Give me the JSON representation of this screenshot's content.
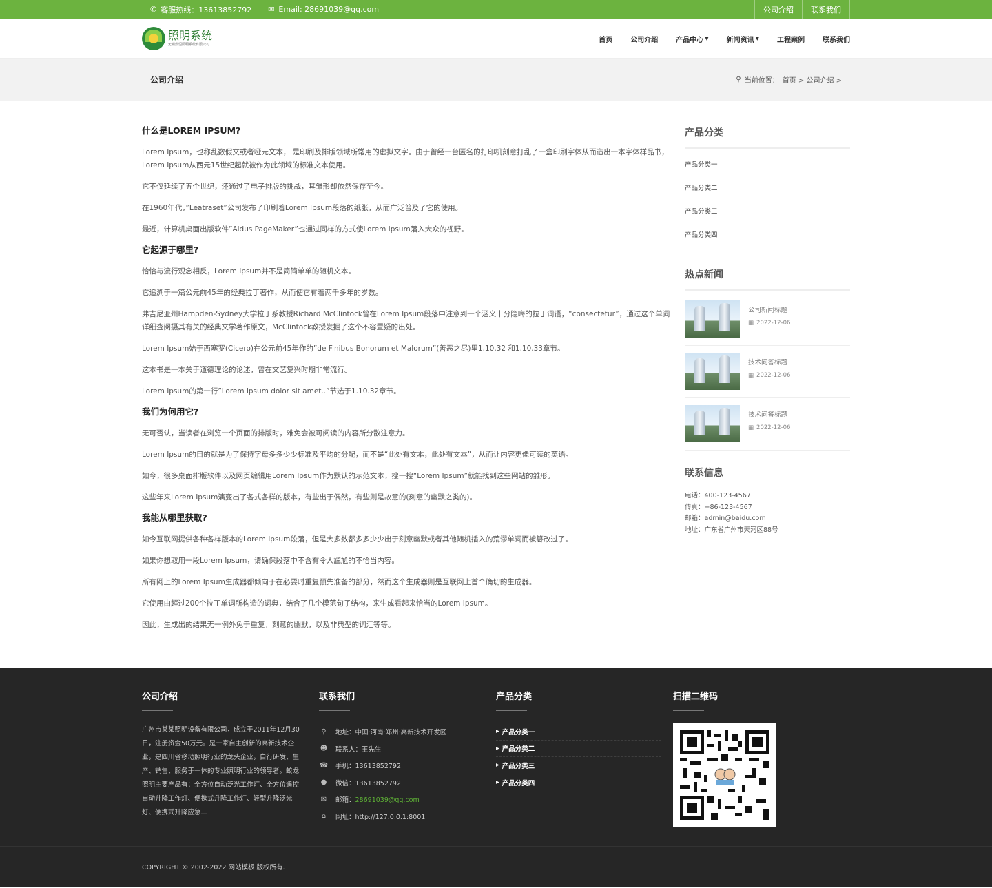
{
  "topbar": {
    "hotline": "客服热线：13613852792",
    "email": "Email: 28691039@qq.com",
    "links": [
      "公司介绍",
      "联系我们"
    ],
    "accent": "#6cb33f"
  },
  "header": {
    "logo_name": "照明系统",
    "logo_sub": "无锡鼎恒照明系统有限公司",
    "nav": [
      {
        "label": "首页",
        "dropdown": false
      },
      {
        "label": "公司介绍",
        "dropdown": false
      },
      {
        "label": "产品中心",
        "dropdown": true
      },
      {
        "label": "新闻资讯",
        "dropdown": true
      },
      {
        "label": "工程案例",
        "dropdown": false
      },
      {
        "label": "联系我们",
        "dropdown": false
      }
    ]
  },
  "banner": {
    "title": "公司介绍",
    "crumb_label": "当前位置：",
    "crumb_path": "首页 > 公司介绍 >"
  },
  "article": {
    "h1": "什么是LOREM IPSUM?",
    "p1": "Lorem Ipsum，也称乱数假文或者哑元文本， 是印刷及排版领域所常用的虚拟文字。由于曾经一台匿名的打印机刻意打乱了一盒印刷字体从而造出一本字体样品书，Lorem Ipsum从西元15世纪起就被作为此领域的标准文本使用。",
    "p2": "它不仅延续了五个世纪，还通过了电子排版的挑战，其雏形却依然保存至今。",
    "p3": "在1960年代，”Leatraset”公司发布了印刷着Lorem Ipsum段落的纸张，从而广泛普及了它的使用。",
    "p4": "最近，计算机桌面出版软件”Aldus PageMaker”也通过同样的方式使Lorem Ipsum落入大众的视野。",
    "h2": "它起源于哪里?",
    "p5": "恰恰与流行观念相反，Lorem Ipsum并不是简简单单的随机文本。",
    "p6": "它追溯于一篇公元前45年的经典拉丁著作，从而使它有着两千多年的岁数。",
    "p7": "弗吉尼亚州Hampden-Sydney大学拉丁系教授Richard McClintock曾在Lorem Ipsum段落中注意到一个涵义十分隐晦的拉丁词语，“consectetur”，通过这个单词详细查阅摄其有关的经典文学著作原文，McClintock教授发掘了这个不容置疑的出处。",
    "p8": "Lorem Ipsum始于西塞罗(Cicero)在公元前45年作的”de Finibus Bonorum et Malorum”(善恶之尽)里1.10.32 和1.10.33章节。",
    "p9": "这本书是一本关于道德理论的论述，曾在文艺复兴时期非常流行。",
    "p10": "Lorem Ipsum的第一行”Lorem ipsum dolor sit amet..”节选于1.10.32章节。",
    "h3": "我们为何用它?",
    "p11": "无可否认，当读者在浏览一个页面的排版时，难免会被可阅读的内容所分散注意力。",
    "p12": "Lorem Ipsum的目的就是为了保持字母多多少少标准及平均的分配，而不是“此处有文本，此处有文本”，从而让内容更像可读的英语。",
    "p13": "如今，很多桌面排版软件以及网页编辑用Lorem Ipsum作为默认的示范文本，搜一搜“Lorem Ipsum”就能找到这些网站的雏形。",
    "p14": "这些年来Lorem Ipsum演变出了各式各样的版本，有些出于偶然，有些则是故意的(刻意的幽默之类的)。",
    "h4": "我能从哪里获取?",
    "p15": "如今互联网提供各种各样版本的Lorem Ipsum段落，但是大多数都多多少少出于刻意幽默或者其他随机插入的荒谬单词而被篡改过了。",
    "p16": "如果你想取用一段Lorem Ipsum，请确保段落中不含有令人尴尬的不恰当内容。",
    "p17": "所有网上的Lorem Ipsum生成器都倾向于在必要时重复预先准备的部分，然而这个生成器则是互联网上首个确切的生成器。",
    "p18": "它使用由超过200个拉丁单词所构造的词典，结合了几个模范句子结构，来生成看起来恰当的Lorem Ipsum。",
    "p19": "因此，生成出的结果无一例外免于重复，刻意的幽默，以及非典型的词汇等等。"
  },
  "sidebar": {
    "cat_title": "产品分类",
    "cats": [
      "产品分类一",
      "产品分类二",
      "产品分类三",
      "产品分类四"
    ],
    "news_title": "热点新闻",
    "news": [
      {
        "title": "公司新闻标题",
        "date": "2022-12-06"
      },
      {
        "title": "技术问答标题",
        "date": "2022-12-06"
      },
      {
        "title": "技术问答标题",
        "date": "2022-12-06"
      }
    ],
    "contact_title": "联系信息",
    "contact": [
      "电话：400-123-4567",
      "传真：+86-123-4567",
      "邮箱：admin@baidu.com",
      "地址：广东省广州市天河区88号"
    ]
  },
  "footer": {
    "about_title": "公司介绍",
    "about_text": "广州市某某照明设备有限公司，成立于2011年12月30日，注册资金50万元。是一家自主创新的高新技术企业，是四川省移动照明行业的龙头企业，自行研发、生产、销售、服务于一体的专业照明行业的领导者。蛟龙照明主要产品有：全方位自动泛光工作灯、全方位遥控自动升降工作灯、便携式升降工作灯、轻型升降泛光灯、便携式升降应急...",
    "contact_title": "联系我们",
    "contact": [
      {
        "icon": "map-marker-icon",
        "label": "地址：",
        "value": "中国·河南·郑州·高新技术开发区"
      },
      {
        "icon": "user-icon",
        "label": "联系人：",
        "value": "王先生"
      },
      {
        "icon": "phone-icon",
        "label": "手机：",
        "value": "13613852792"
      },
      {
        "icon": "wechat-icon",
        "label": "微信：",
        "value": "13613852792"
      },
      {
        "icon": "envelope-icon",
        "label": "邮箱：",
        "value": "28691039@qq.com"
      },
      {
        "icon": "home-icon",
        "label": "网址：",
        "value": "http://127.0.0.1:8001"
      }
    ],
    "product_title": "产品分类",
    "products": [
      "产品分类一",
      "产品分类二",
      "产品分类三",
      "产品分类四"
    ],
    "qr_title": "扫描二维码",
    "copyright": "COPYRIGHT © 2002-2022 网站模板 版权所有."
  }
}
